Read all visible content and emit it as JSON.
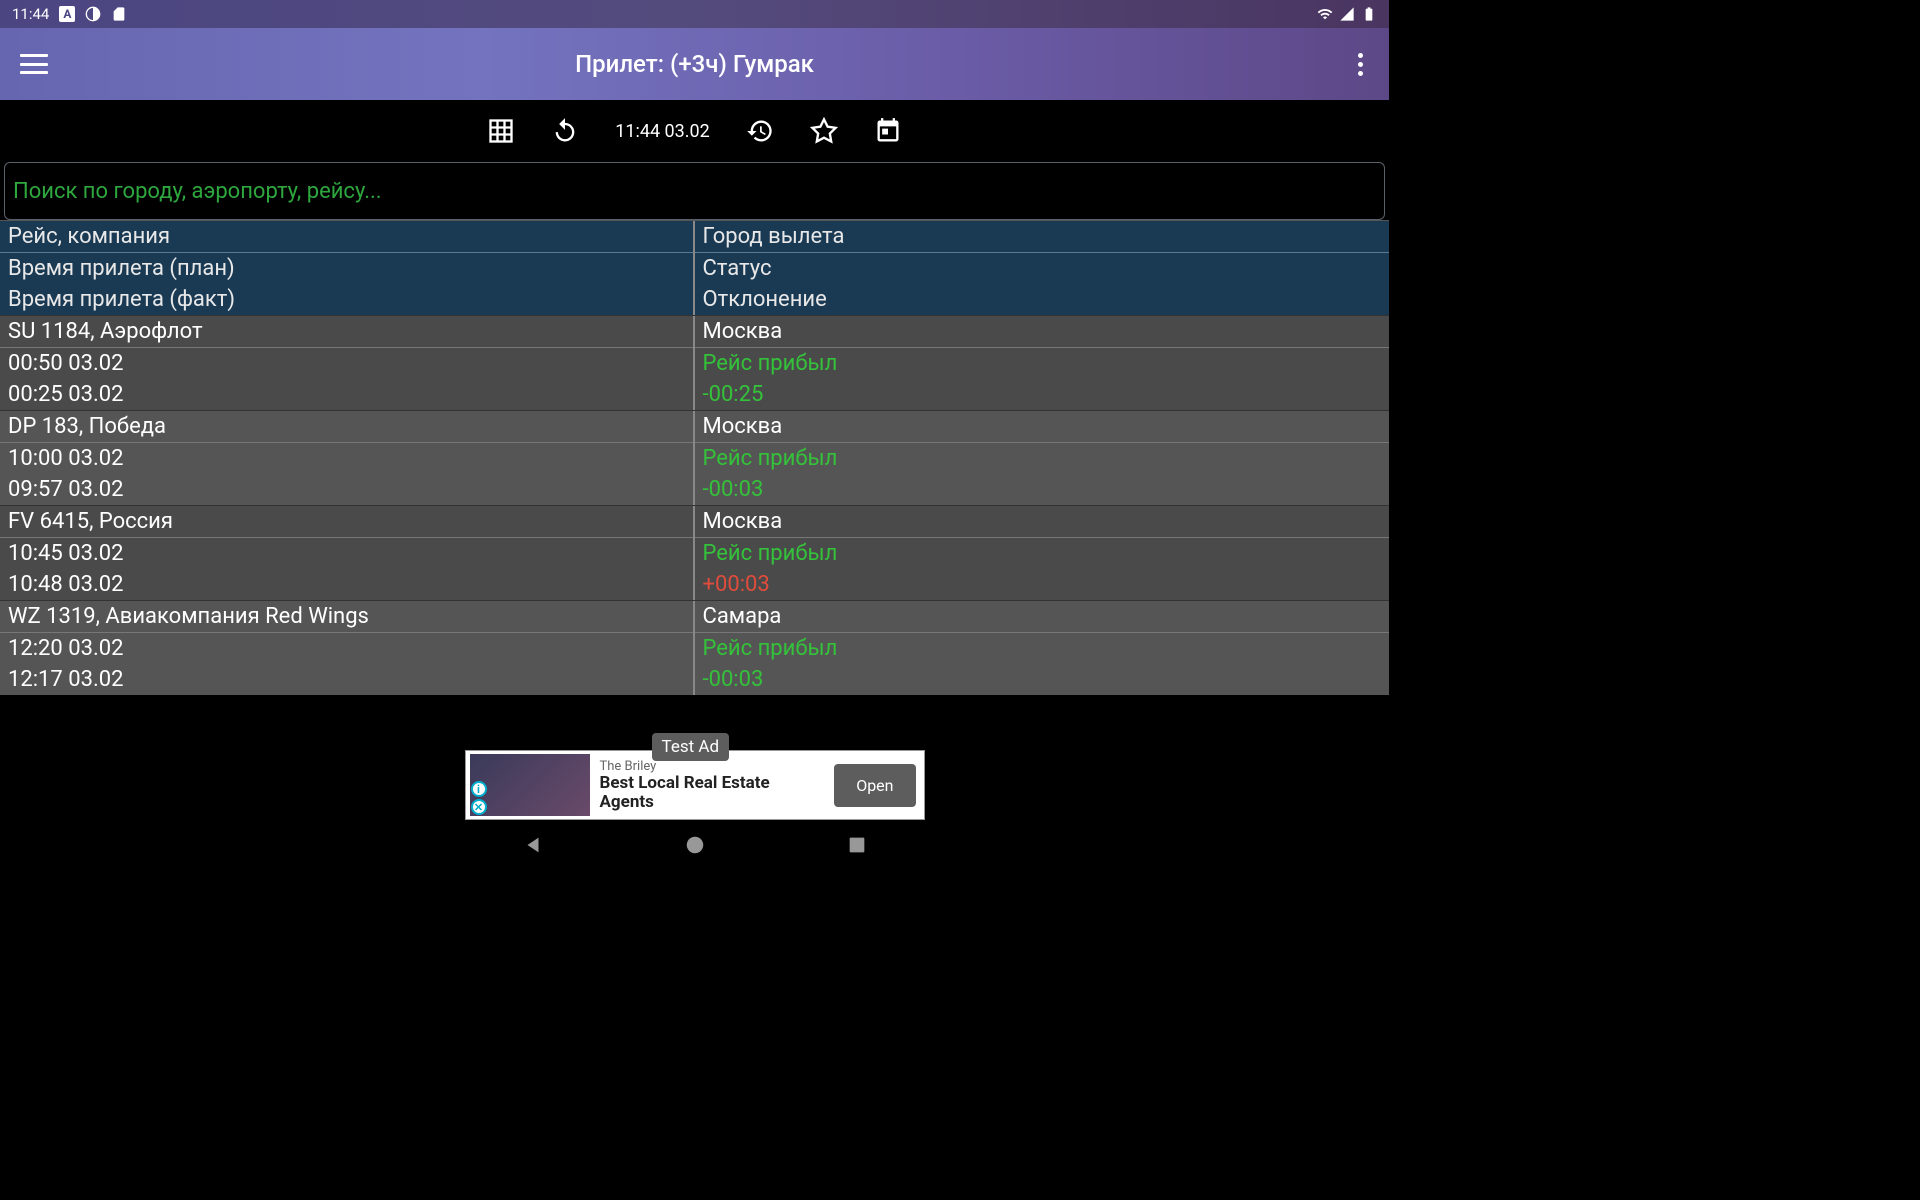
{
  "status_bar": {
    "time": "11:44",
    "icons": {
      "a": "A",
      "contrast": "contrast-icon",
      "card": "card-icon",
      "wifi": "wifi-icon",
      "signal": "signal-icon",
      "battery": "battery-icon"
    }
  },
  "app_bar": {
    "title": "Прилет: (+3ч) Гумрак"
  },
  "toolbar": {
    "datetime": "11:44 03.02"
  },
  "search": {
    "placeholder": "Поиск по городу, аэропорту, рейсу..."
  },
  "headers": {
    "flight": "Рейс, компания",
    "time_plan": "Время прилета (план)",
    "time_fact": "Время прилета (факт)",
    "city": "Город вылета",
    "status": "Статус",
    "deviation": "Отклонение"
  },
  "flights": [
    {
      "flight": "SU 1184, Аэрофлот",
      "city": "Москва",
      "time_plan": "00:50 03.02",
      "time_fact": "00:25 03.02",
      "status": "Рейс прибыл",
      "deviation": "-00:25",
      "deviation_class": "status-green"
    },
    {
      "flight": "DP 183, Победа",
      "city": "Москва",
      "time_plan": "10:00 03.02",
      "time_fact": "09:57 03.02",
      "status": "Рейс прибыл",
      "deviation": "-00:03",
      "deviation_class": "status-green"
    },
    {
      "flight": "FV 6415, Россия",
      "city": "Москва",
      "time_plan": "10:45 03.02",
      "time_fact": "10:48 03.02",
      "status": "Рейс прибыл",
      "deviation": "+00:03",
      "deviation_class": "status-red"
    },
    {
      "flight": "WZ 1319, Авиакомпания Red Wings",
      "city": "Самара",
      "time_plan": "12:20 03.02",
      "time_fact": "12:17 03.02",
      "status": "Рейс прибыл",
      "deviation": "-00:03",
      "deviation_class": "status-green"
    }
  ],
  "ad": {
    "test_label": "Test Ad",
    "subtitle": "The Briley",
    "title": "Best Local Real Estate Agents",
    "button": "Open"
  }
}
